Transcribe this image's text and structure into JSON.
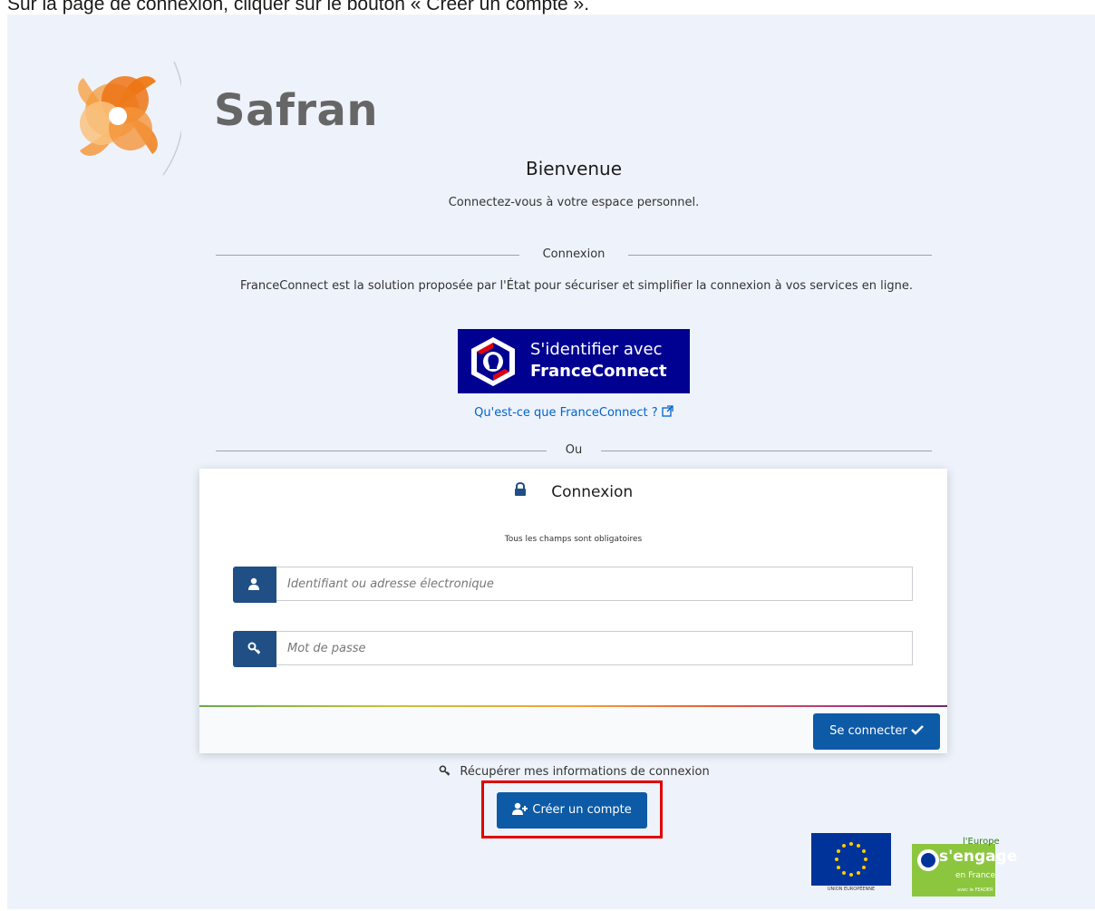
{
  "caption": "Sur la page de connexion, cliquer sur le bouton « Créer un compte ».",
  "brand": {
    "name": "Safran",
    "orange": "#ef8a2a"
  },
  "welcome": {
    "title": "Bienvenue",
    "subtitle": "Connectez-vous à votre espace personnel."
  },
  "france_connect": {
    "section_label": "Connexion",
    "description": "FranceConnect est la solution proposée par l'État pour sécuriser et simplifier la connexion à vos services en ligne.",
    "button_line1": "S'identifier avec",
    "button_line2": "FranceConnect",
    "info_link": "Qu'est-ce que FranceConnect ?",
    "icon": "external-link-icon"
  },
  "or_label": "Ou",
  "login_card": {
    "title": "Connexion",
    "title_icon": "lock-icon",
    "required_note": "Tous les champs sont obligatoires",
    "username_placeholder": "Identifiant ou adresse électronique",
    "username_icon": "user-icon",
    "password_placeholder": "Mot de passe",
    "password_icon": "key-icon",
    "submit_label": "Se connecter",
    "submit_icon": "check-icon",
    "accent": "#0d5aa7"
  },
  "recover_link": "Récupérer mes informations de connexion",
  "create_account_label": "Créer un compte",
  "create_account_icon": "user-plus-icon",
  "footer_logos": {
    "eu_label": "UNION EUROPÉENNE",
    "europe_line1": "l'Europe",
    "europe_line2": "s'engage",
    "europe_line3": "en France",
    "europe_line4": "avec le FEADER"
  }
}
